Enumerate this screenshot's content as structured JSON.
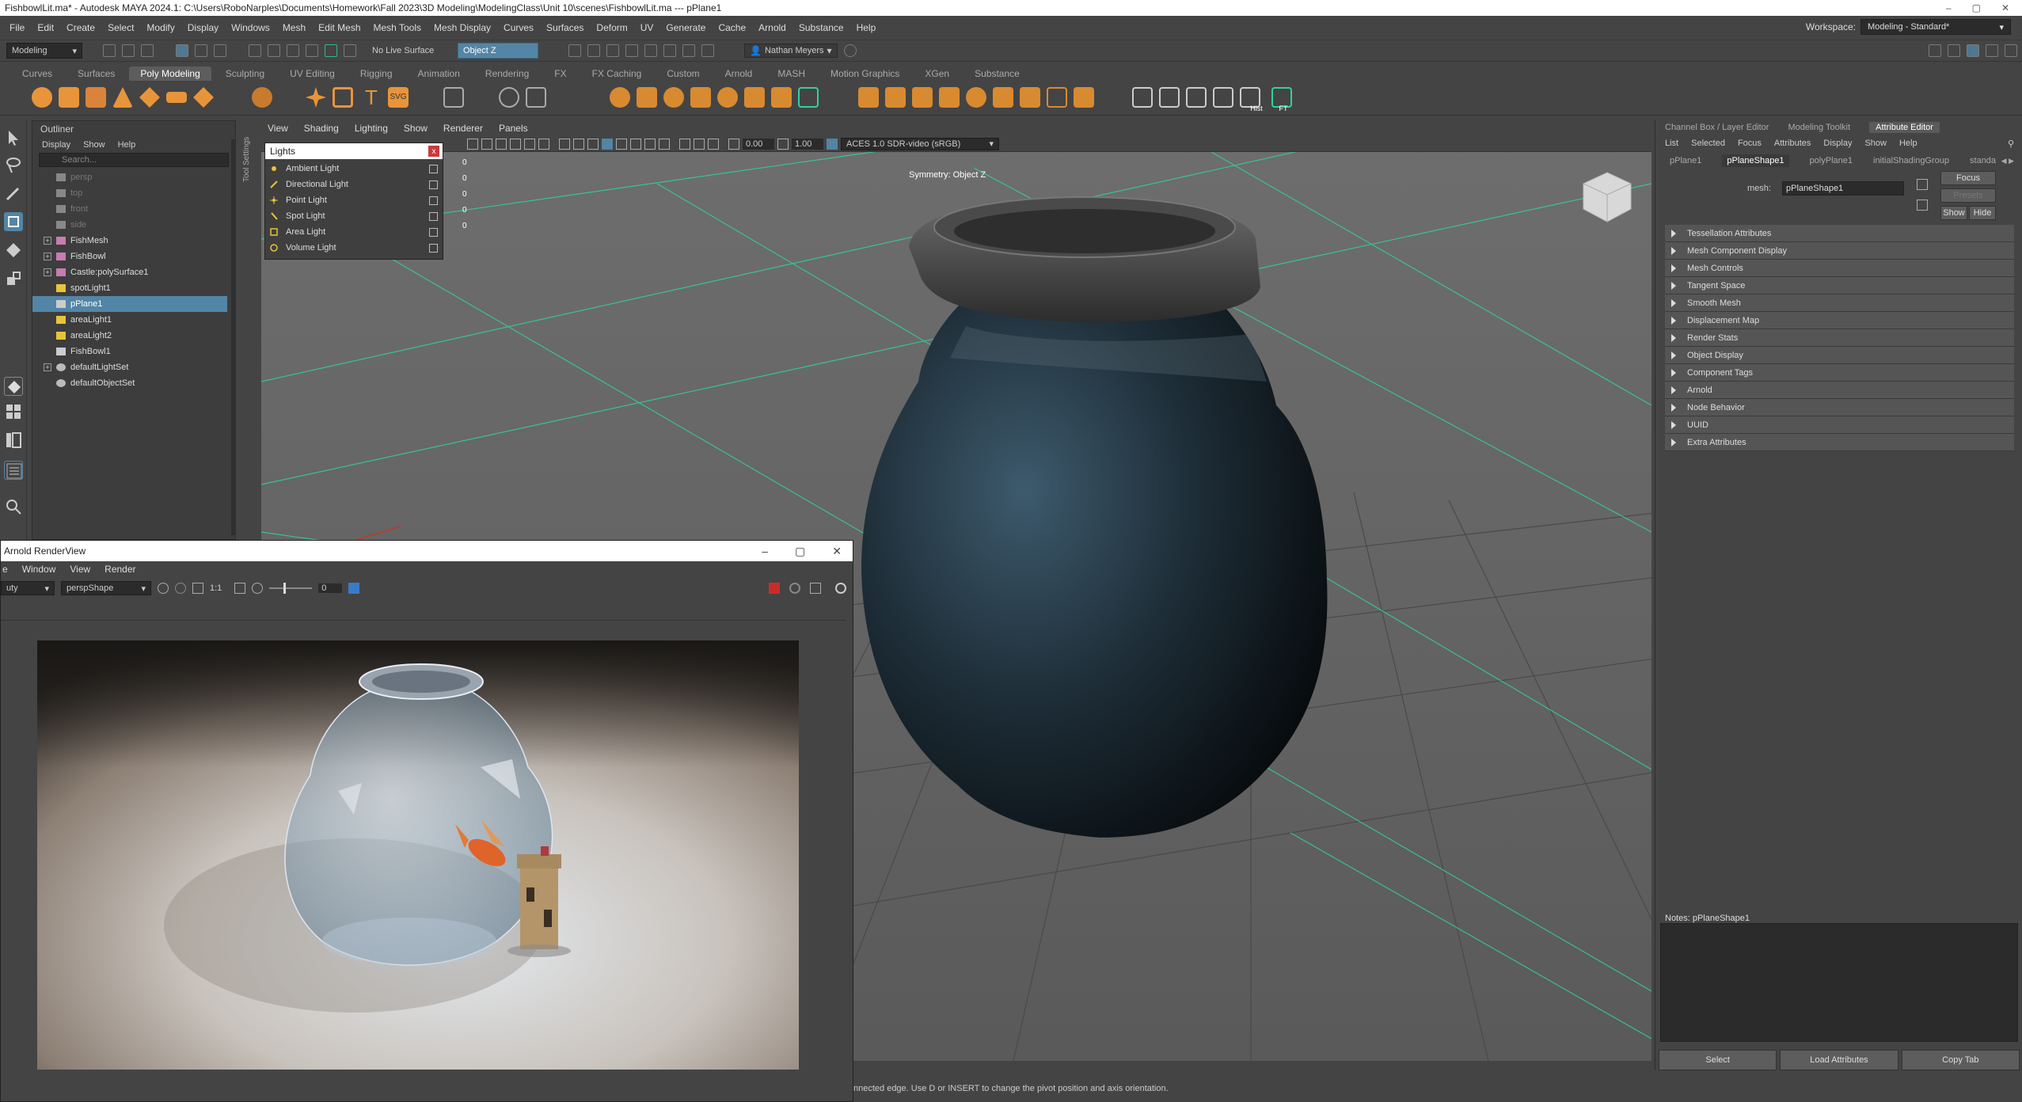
{
  "window": {
    "title": "FishbowlLit.ma* - Autodesk MAYA 2024.1: C:\\Users\\RoboNarples\\Documents\\Homework\\Fall 2023\\3D Modeling\\ModelingClass\\Unit 10\\scenes\\FishbowlLit.ma  ---  pPlane1",
    "controls": [
      "–",
      "▢",
      "✕"
    ]
  },
  "menubar": {
    "items": [
      "File",
      "Edit",
      "Create",
      "Select",
      "Modify",
      "Display",
      "Windows",
      "Mesh",
      "Edit Mesh",
      "Mesh Tools",
      "Mesh Display",
      "Curves",
      "Surfaces",
      "Deform",
      "UV",
      "Generate",
      "Cache",
      "Arnold",
      "Substance",
      "Help"
    ],
    "workspace_label": "Workspace:",
    "workspace_value": "Modeling - Standard*"
  },
  "statusline": {
    "mode": "Modeling",
    "live_surface": "No Live Surface",
    "symmetry": "Object Z",
    "user": "Nathan Meyers"
  },
  "shelf": {
    "tabs": [
      "Curves",
      "Surfaces",
      "Poly Modeling",
      "Sculpting",
      "UV Editing",
      "Rigging",
      "Animation",
      "Rendering",
      "FX",
      "FX Caching",
      "Custom",
      "Arnold",
      "MASH",
      "Motion Graphics",
      "XGen",
      "Substance"
    ],
    "active_tab": "Poly Modeling",
    "icon_labels": {
      "hist": "Hist",
      "ft": "FT",
      "svg": "SVG",
      "text": "T"
    }
  },
  "outliner": {
    "title": "Outliner",
    "menus": [
      "Display",
      "Show",
      "Help"
    ],
    "search_placeholder": "Search...",
    "items": [
      {
        "label": "persp",
        "type": "camera",
        "dim": true,
        "expand": false
      },
      {
        "label": "top",
        "type": "camera",
        "dim": true,
        "expand": false
      },
      {
        "label": "front",
        "type": "camera",
        "dim": true,
        "expand": false
      },
      {
        "label": "side",
        "type": "camera",
        "dim": true,
        "expand": false
      },
      {
        "label": "FishMesh",
        "type": "mesh",
        "dim": false,
        "expand": true
      },
      {
        "label": "FishBowl",
        "type": "mesh",
        "dim": false,
        "expand": true
      },
      {
        "label": "Castle:polySurface1",
        "type": "mesh",
        "dim": false,
        "expand": true
      },
      {
        "label": "spotLight1",
        "type": "light",
        "dim": false,
        "expand": false
      },
      {
        "label": "pPlane1",
        "type": "plane",
        "dim": false,
        "expand": false,
        "selected": true
      },
      {
        "label": "areaLight1",
        "type": "light",
        "dim": false,
        "expand": false
      },
      {
        "label": "areaLight2",
        "type": "light",
        "dim": false,
        "expand": false
      },
      {
        "label": "FishBowl1",
        "type": "plane",
        "dim": false,
        "expand": false
      },
      {
        "label": "defaultLightSet",
        "type": "set",
        "dim": false,
        "expand": true
      },
      {
        "label": "defaultObjectSet",
        "type": "set",
        "dim": false,
        "expand": false
      }
    ]
  },
  "viewport": {
    "menus": [
      "View",
      "Shading",
      "Lighting",
      "Show",
      "Renderer",
      "Panels"
    ],
    "exposure": "0.00",
    "gamma": "1.00",
    "colorspace": "ACES 1.0 SDR-video (sRGB)",
    "symmetry_label": "Symmetry: Object Z",
    "side_label": "Tool Settings",
    "hud_values": [
      "0",
      "0",
      "0",
      "0",
      "0"
    ]
  },
  "lights_popup": {
    "title": "Lights",
    "close": "x",
    "items": [
      "Ambient Light",
      "Directional Light",
      "Point Light",
      "Spot Light",
      "Area Light",
      "Volume Light"
    ]
  },
  "renderview": {
    "title": "Arnold RenderView",
    "menus": [
      "e",
      "Window",
      "View",
      "Render"
    ],
    "aov": "uty",
    "camera": "perspShape",
    "ratio": "1:1",
    "exposure": "0"
  },
  "attribute_editor": {
    "panel_tabs": [
      "Channel Box / Layer Editor",
      "Modeling Toolkit",
      "Attribute Editor"
    ],
    "active_panel_tab": "Attribute Editor",
    "menus": [
      "List",
      "Selected",
      "Focus",
      "Attributes",
      "Display",
      "Show",
      "Help"
    ],
    "node_tabs": [
      "pPlane1",
      "pPlaneShape1",
      "polyPlane1",
      "initialShadingGroup",
      "standa"
    ],
    "active_node_tab": "pPlaneShape1",
    "mesh_label": "mesh:",
    "mesh_value": "pPlaneShape1",
    "focus_btn": "Focus",
    "presets_btn": "Presets",
    "show_btn": "Show",
    "hide_btn": "Hide",
    "sections": [
      "Tessellation Attributes",
      "Mesh Component Display",
      "Mesh Controls",
      "Tangent Space",
      "Smooth Mesh",
      "Displacement Map",
      "Render Stats",
      "Object Display",
      "Component Tags",
      "Arnold",
      "Node Behavior",
      "UUID",
      "Extra Attributes"
    ],
    "notes_label": "Notes:  pPlaneShape1",
    "bottom_buttons": [
      "Select",
      "Load Attributes",
      "Copy Tab"
    ]
  },
  "helpline": "nnected edge. Use D or INSERT to change the pivot position and axis orientation.",
  "colors": {
    "selection": "#5285a6",
    "grid_axis": "#2fd39a",
    "shelf_orange": "#e8943a"
  }
}
